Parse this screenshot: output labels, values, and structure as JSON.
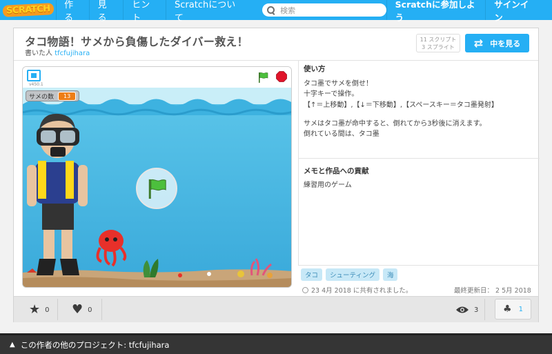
{
  "nav": {
    "logo": "SCRATCH",
    "items": [
      "作る",
      "見る",
      "ヒント",
      "Scratchについて"
    ],
    "search_placeholder": "検索",
    "join": "Scratchに参加しよう",
    "signin": "サインイン"
  },
  "project": {
    "title": "タコ物語！サメから負傷したダイバー救え！",
    "by_label": "書いた人",
    "author": "tfcfujihara",
    "scripts": "11 スクリプト",
    "sprites": "3 スプライト",
    "see_inside": "中を見る"
  },
  "player": {
    "version": "v450.1",
    "monitor_label": "サメの数",
    "monitor_value": "13"
  },
  "instructions": {
    "heading": "使い方",
    "lines": [
      "タコ墨でサメを倒せ！",
      "十字キーで操作。",
      "【↑＝上移動】,【↓＝下移動】,【スペースキー＝タコ墨発射】",
      "サメはタコ墨が命中すると、倒れてから3秒後に消えます。",
      "倒れている間は、タコ墨"
    ]
  },
  "credits": {
    "heading": "メモと作品への貢献",
    "text": "練習用のゲーム"
  },
  "tags": [
    "タコ",
    "シューティング",
    "海"
  ],
  "meta": {
    "shared": "23 4月 2018 に共有されました。",
    "modified": "最終更新日： 2 5月 2018"
  },
  "actions": {
    "favorites": "0",
    "loves": "0",
    "views": "3",
    "remixes": "1"
  },
  "footer": {
    "text": "この作者の他のプロジェクト: tfcfujihara"
  }
}
